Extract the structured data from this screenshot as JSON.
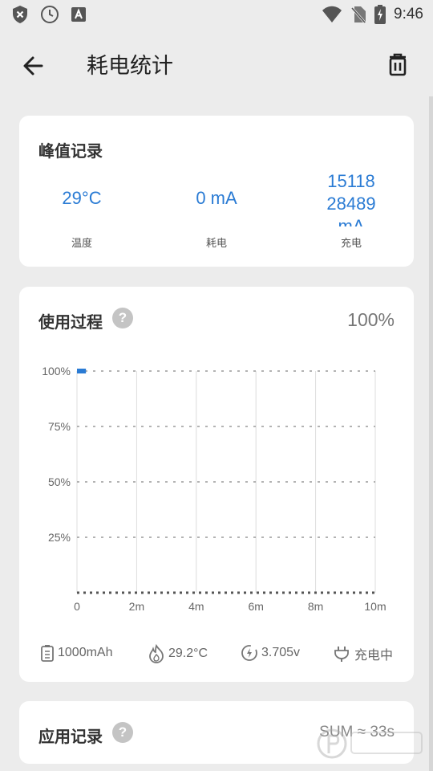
{
  "status_bar": {
    "time": "9:46"
  },
  "app_bar": {
    "title": "耗电统计"
  },
  "peak_card": {
    "title": "峰值记录",
    "items": [
      {
        "value": "29°C",
        "label": "温度"
      },
      {
        "value": "0 mA",
        "label": "耗电"
      },
      {
        "value": "15118",
        "value2": "28489",
        "value3": "mA",
        "label": "充电"
      }
    ]
  },
  "usage_card": {
    "title": "使用过程",
    "help": "?",
    "percent": "100%",
    "footer": {
      "capacity": "1000mAh",
      "temperature": "29.2°C",
      "voltage": "3.705v",
      "state": "充电中"
    }
  },
  "chart_data": {
    "type": "line",
    "x_ticks": [
      "0",
      "2m",
      "4m",
      "6m",
      "8m",
      "10m"
    ],
    "y_ticks": [
      "100%",
      "75%",
      "50%",
      "25%"
    ],
    "xlim": [
      0,
      10
    ],
    "ylim": [
      0,
      100
    ],
    "series": [
      {
        "x": [
          0,
          0.3
        ],
        "y": [
          100,
          100
        ]
      }
    ],
    "grid": true
  },
  "app_record_card": {
    "title": "应用记录",
    "help": "?",
    "sum": "SUM ≈ 33s"
  }
}
